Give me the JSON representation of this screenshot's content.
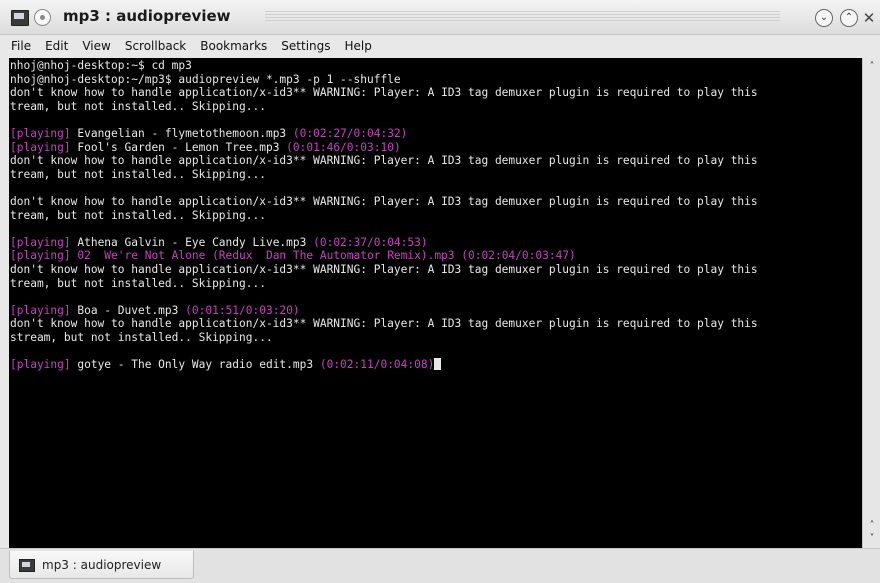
{
  "window": {
    "title": "mp3 : audiopreview",
    "buttons": {
      "minimize": "⌄",
      "maximize": "⌃",
      "close": "✕"
    }
  },
  "menubar": {
    "items": [
      {
        "label": "File"
      },
      {
        "label": "Edit"
      },
      {
        "label": "View"
      },
      {
        "label": "Scrollback"
      },
      {
        "label": "Bookmarks"
      },
      {
        "label": "Settings"
      },
      {
        "label": "Help"
      }
    ]
  },
  "terminal": {
    "colors": {
      "background": "#000000",
      "text": "#e8e8e8",
      "highlight": "#c83fc3"
    },
    "lines": [
      {
        "segments": [
          {
            "text": "nhoj@nhoj-desktop:~$ cd mp3",
            "style": "normal"
          }
        ]
      },
      {
        "segments": [
          {
            "text": "nhoj@nhoj-desktop:~/mp3$ audiopreview *.mp3 -p 1 --shuffle",
            "style": "normal"
          }
        ]
      },
      {
        "segments": [
          {
            "text": "don't know how to handle application/x-id3** WARNING: Player: A ID3 tag demuxer plugin is required to play this",
            "style": "normal"
          }
        ]
      },
      {
        "segments": [
          {
            "text": "tream, but not installed.. Skipping...",
            "style": "normal"
          }
        ]
      },
      {
        "segments": []
      },
      {
        "segments": [
          {
            "text": "[playing]",
            "style": "tag"
          },
          {
            "text": " Evangelian - flymetothemoon.mp3 ",
            "style": "normal"
          },
          {
            "text": "(0:02:27/0:04:32)",
            "style": "time"
          }
        ]
      },
      {
        "segments": [
          {
            "text": "[playing]",
            "style": "tag"
          },
          {
            "text": " Fool's Garden - Lemon Tree.mp3 ",
            "style": "normal"
          },
          {
            "text": "(0:01:46/0:03:10)",
            "style": "time"
          }
        ]
      },
      {
        "segments": [
          {
            "text": "don't know how to handle application/x-id3** WARNING: Player: A ID3 tag demuxer plugin is required to play this",
            "style": "normal"
          }
        ]
      },
      {
        "segments": [
          {
            "text": "tream, but not installed.. Skipping...",
            "style": "normal"
          }
        ]
      },
      {
        "segments": []
      },
      {
        "segments": [
          {
            "text": "don't know how to handle application/x-id3** WARNING: Player: A ID3 tag demuxer plugin is required to play this",
            "style": "normal"
          }
        ]
      },
      {
        "segments": [
          {
            "text": "tream, but not installed.. Skipping...",
            "style": "normal"
          }
        ]
      },
      {
        "segments": []
      },
      {
        "segments": [
          {
            "text": "[playing]",
            "style": "tag"
          },
          {
            "text": " Athena Galvin - Eye Candy Live.mp3 ",
            "style": "normal"
          },
          {
            "text": "(0:02:37/0:04:53)",
            "style": "time"
          }
        ]
      },
      {
        "segments": [
          {
            "text": "[playing]",
            "style": "tag"
          },
          {
            "text": " 02  We're Not Alone (Redux  Dan The Automator Remix).mp3 ",
            "style": "tag"
          },
          {
            "text": "(0:02:04/0:03:47)",
            "style": "time"
          }
        ]
      },
      {
        "segments": [
          {
            "text": "don't know how to handle application/x-id3** WARNING: Player: A ID3 tag demuxer plugin is required to play this",
            "style": "normal"
          }
        ]
      },
      {
        "segments": [
          {
            "text": "tream, but not installed.. Skipping...",
            "style": "normal"
          }
        ]
      },
      {
        "segments": []
      },
      {
        "segments": [
          {
            "text": "[playing]",
            "style": "tag"
          },
          {
            "text": " Boa - Duvet.mp3 ",
            "style": "normal"
          },
          {
            "text": "(0:01:51/0:03:20)",
            "style": "time"
          }
        ]
      },
      {
        "segments": [
          {
            "text": "don't know how to handle application/x-id3** WARNING: Player: A ID3 tag demuxer plugin is required to play this",
            "style": "normal"
          }
        ]
      },
      {
        "segments": [
          {
            "text": "stream, but not installed.. Skipping...",
            "style": "normal"
          }
        ]
      },
      {
        "segments": []
      },
      {
        "segments": [
          {
            "text": "[playing]",
            "style": "tag"
          },
          {
            "text": " gotye - The Only Way radio edit.mp3 ",
            "style": "normal"
          },
          {
            "text": "(0:02:11/0:04:08)",
            "style": "time"
          }
        ],
        "cursor": true
      }
    ]
  },
  "scrollbar": {
    "up": "˄",
    "down": "˅"
  },
  "tabs": [
    {
      "label": "mp3 : audiopreview"
    }
  ]
}
